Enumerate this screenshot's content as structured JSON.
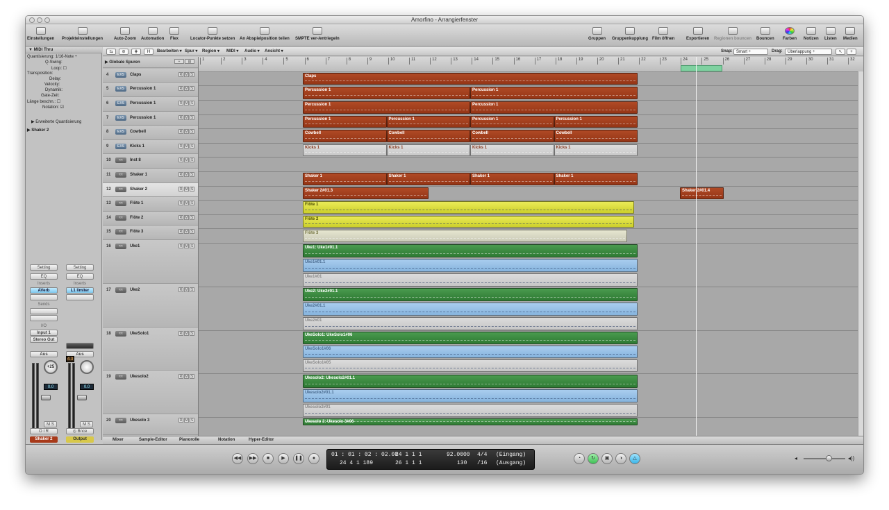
{
  "window": {
    "title": "Amorfino - Arrangierfenster"
  },
  "toolbar": {
    "einstellungen": "Einstellungen",
    "projekteinstellungen": "Projekteinstellungen",
    "autozoom": "Auto-Zoom",
    "automation": "Automation",
    "flex": "Flex",
    "locator": "Locator-Punkte setzen",
    "abspiel": "An Abspielposition teilen",
    "smpte": "SMPTE ver-/entriegeln",
    "gruppen": "Gruppen",
    "gruppenkupplung": "Gruppenkupplung",
    "film": "Film öffnen",
    "exportieren": "Exportieren",
    "regionenbouncen": "Regionen bouncen",
    "bouncen": "Bouncen",
    "farben": "Farben",
    "notizen": "Notizen",
    "listen": "Listen",
    "medien": "Medien"
  },
  "inspector": {
    "header": "MIDI Thru",
    "params": [
      {
        "label": "Quantisierung:",
        "value": "1/16-Note"
      },
      {
        "label": "Q-Swing:",
        "value": ""
      },
      {
        "label": "Loop:",
        "value": ""
      },
      {
        "label": "Transposition:",
        "value": ""
      },
      {
        "label": "Delay:",
        "value": ""
      },
      {
        "label": "Velocity:",
        "value": ""
      },
      {
        "label": "Dynamik:",
        "value": ""
      },
      {
        "label": "Gate-Zeit:",
        "value": ""
      },
      {
        "label": "Länge beschn.:",
        "value": ""
      },
      {
        "label": "Notation:",
        "value": ""
      }
    ],
    "erweitert": "Erweiterte Quantisierung",
    "shaker": "Shaker 2",
    "strip1": {
      "setting": "Setting",
      "eq": "EQ",
      "inserts": "Inserts",
      "insert": "AVerb",
      "sends": "Sends",
      "io": "I/O",
      "input": "Input 1",
      "output": "Stereo Out",
      "aus": "Aus",
      "pan": "+25",
      "value": "0.0",
      "name": "Shaker 2",
      "m": "M",
      "s": "S",
      "o": "O",
      "i": "I",
      "r": "R"
    },
    "strip2": {
      "setting": "Setting",
      "eq": "EQ",
      "inserts": "Inserts",
      "insert": "L1 limiter",
      "aus": "Aus",
      "value": "0.0",
      "name": "Output",
      "m": "M",
      "s": "S",
      "bnce": "Bnce",
      "level": "4.3"
    }
  },
  "localbar": {
    "bearbeiten": "Bearbeiten",
    "spur": "Spur",
    "region": "Region",
    "midi": "MIDI",
    "audio": "Audio",
    "ansicht": "Ansicht",
    "snap_label": "Snap:",
    "snap_value": "Smart",
    "drag_label": "Drag:",
    "drag_value": "Überlappung",
    "h": "H"
  },
  "globale": "Globale Spuren",
  "ruler": [
    "1",
    "2",
    "3",
    "4",
    "5",
    "6",
    "7",
    "8",
    "9",
    "10",
    "11",
    "12",
    "13",
    "14",
    "15",
    "16",
    "17",
    "18",
    "19",
    "20",
    "21",
    "22",
    "23",
    "24",
    "25",
    "26",
    "27",
    "28",
    "29",
    "30",
    "31",
    "32"
  ],
  "tracks": [
    {
      "num": "4",
      "type": "EXS",
      "name": "Claps",
      "h": 20
    },
    {
      "num": "5",
      "type": "EXS",
      "name": "Percussion 1",
      "h": 21
    },
    {
      "num": "6",
      "type": "EXS",
      "name": "Percussion 1",
      "h": 21
    },
    {
      "num": "7",
      "type": "EXS",
      "name": "Percussion 1",
      "h": 20
    },
    {
      "num": "8",
      "type": "EXS",
      "name": "Cowbell",
      "h": 21
    },
    {
      "num": "9",
      "type": "EXS",
      "name": "Kicks 1",
      "h": 20
    },
    {
      "num": "10",
      "type": "",
      "name": "Inst 8",
      "h": 21
    },
    {
      "num": "11",
      "type": "",
      "name": "Shaker 1",
      "h": 21
    },
    {
      "num": "12",
      "type": "",
      "name": "Shaker 2",
      "h": 20
    },
    {
      "num": "13",
      "type": "",
      "name": "Flöte 1",
      "h": 21
    },
    {
      "num": "14",
      "type": "",
      "name": "Flöte 2",
      "h": 20
    },
    {
      "num": "15",
      "type": "",
      "name": "Flöte 3",
      "h": 21
    },
    {
      "num": "16",
      "type": "",
      "name": "Uke1",
      "h": 63
    },
    {
      "num": "17",
      "type": "",
      "name": "Uke2",
      "h": 63
    },
    {
      "num": "18",
      "type": "",
      "name": "UkeSolo1",
      "h": 62
    },
    {
      "num": "19",
      "type": "",
      "name": "Ukesolo2",
      "h": 63
    },
    {
      "num": "20",
      "type": "",
      "name": "Ukesolo 3",
      "h": 30
    }
  ],
  "regions": {
    "claps": "Claps",
    "perc1": "Percussion 1",
    "cowbell": "Cowbell",
    "kicks": "Kicks 1",
    "shaker1": "Shaker 1",
    "shaker2": "Shaker 2#01.3",
    "shaker2b": "Shaker 2#01.4",
    "floete1": "Flöte 1",
    "floete2": "Flöte 2",
    "floete3": "Flöte 3",
    "uke1": "Uke1: Uke1#01.1",
    "uke1a": "Uke1#01.1",
    "uke1b": "Uke1#01",
    "uke2": "Uke2: Uke2#01.1",
    "uke2a": "Uke2#01.1",
    "uke2b": "Uke2#01",
    "ukesolo1": "UkeSolo1: UkeSolo1#06",
    "ukesolo1a": "UkeSolo1#06",
    "ukesolo1b": "UkeSolo1#05",
    "ukesolo2": "Ukesolo2: Ukesolo2#01.1",
    "ukesolo2a": "Ukesolo2#01.1",
    "ukesolo2b": "Ukesolo2#01",
    "ukesolo3": "Ukesolo 3: Ukesolo 3#06"
  },
  "tabs": [
    "Mixer",
    "Sample-Editor",
    "Pianorolle",
    "Notation",
    "Hyper-Editor"
  ],
  "lcd": {
    "time": "01 : 01 : 02 : 02.08",
    "bars": "24  4  1  189",
    "pos1": "24   1   1   1",
    "pos2": "26   1   1   1",
    "tempo": "92.0000",
    "tempo2": "130",
    "sig": "4/4",
    "div": "/16",
    "in": "(Eingang)",
    "out": "(Ausgang)"
  }
}
